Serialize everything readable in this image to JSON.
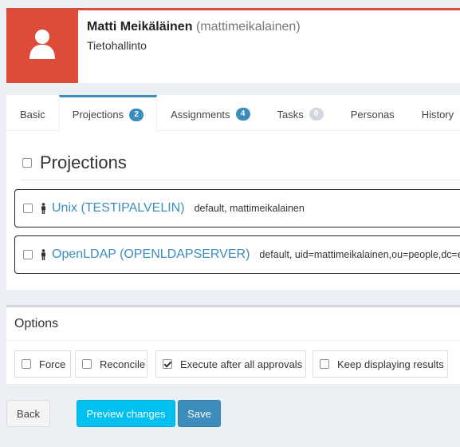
{
  "user": {
    "name": "Matti Meikäläinen",
    "login": "(mattimeikalainen)",
    "organization": "Tietohallinto",
    "avatar_icon": "user-icon",
    "accent_color": "#dd4b39"
  },
  "tabs": [
    {
      "label": "Basic",
      "badge": null
    },
    {
      "label": "Projections",
      "badge": "2",
      "active": true
    },
    {
      "label": "Assignments",
      "badge": "4"
    },
    {
      "label": "Tasks",
      "badge": "0"
    },
    {
      "label": "Personas",
      "badge": null
    },
    {
      "label": "History",
      "badge": null
    }
  ],
  "projections": {
    "title": "Projections",
    "items": [
      {
        "link": "Unix (TESTIPALVELIN)",
        "description": "default, mattimeikalainen",
        "icon": "person-icon"
      },
      {
        "link": "OpenLDAP (OPENLDAPSERVER)",
        "description": "default, uid=mattimeikalainen,ou=people,dc=example,dc=com",
        "icon": "person-icon"
      }
    ]
  },
  "options": {
    "title": "Options",
    "items": [
      {
        "label": "Force",
        "checked": false
      },
      {
        "label": "Reconcile",
        "checked": false
      },
      {
        "label": "Execute after all approvals",
        "checked": true
      },
      {
        "label": "Keep displaying results",
        "checked": false
      }
    ]
  },
  "buttons": {
    "back": "Back",
    "preview": "Preview changes",
    "save": "Save"
  }
}
